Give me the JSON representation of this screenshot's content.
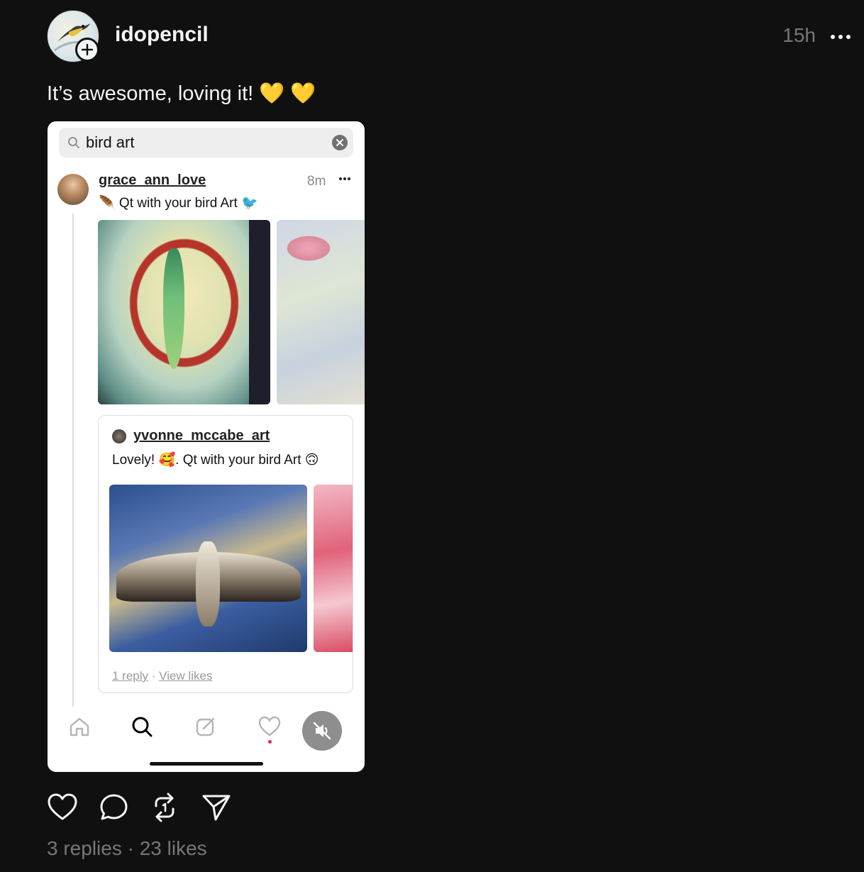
{
  "post": {
    "username": "idopencil",
    "time": "15h",
    "caption": "It’s awesome, loving it! 💛 💛",
    "replies": "3 replies",
    "separator": "·",
    "likes": "23 likes"
  },
  "screenshot": {
    "search": {
      "value": "bird art"
    },
    "post": {
      "username": "grace_ann_love",
      "time": "8m",
      "text": "🪶 Qt with your bird Art 🐦"
    },
    "quote": {
      "username": "yvonne_mccabe_art",
      "text": "Lovely! 🥰. Qt with your bird Art 🙃",
      "reply_link": "1 reply",
      "dot": "·",
      "likes_link": "View likes"
    }
  },
  "icons": [
    "plus-icon",
    "more-icon",
    "search-icon",
    "clear-icon",
    "home-icon",
    "compose-icon",
    "heart-icon",
    "mute-icon",
    "comment-icon",
    "repost-icon",
    "share-icon"
  ]
}
